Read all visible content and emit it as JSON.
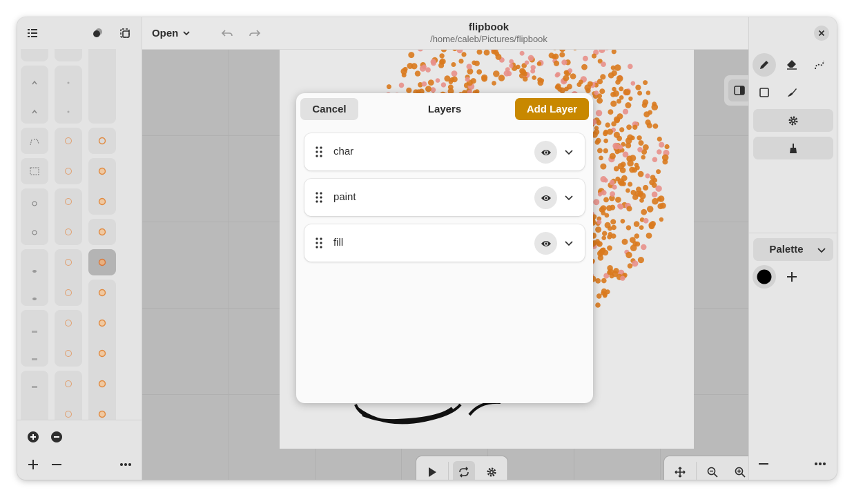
{
  "header": {
    "title": "flipbook",
    "subtitle": "/home/caleb/Pictures/flipbook",
    "open_label": "Open"
  },
  "dialog": {
    "title": "Layers",
    "cancel_label": "Cancel",
    "add_label": "Add Layer",
    "layers": [
      {
        "name": "char"
      },
      {
        "name": "paint"
      },
      {
        "name": "fill"
      }
    ]
  },
  "palette": {
    "label": "Palette",
    "colors": [
      "#000000"
    ]
  },
  "colors": {
    "accent": "#c88800",
    "dots": "#d97a1e",
    "dots_light": "#e8908a"
  },
  "icons": {
    "sidebar": [
      "list-icon",
      "onion-skin-icon",
      "selection-icon",
      "add-circle-icon",
      "remove-circle-icon",
      "plus-icon",
      "minus-icon",
      "more-icon"
    ],
    "topbar": [
      "undo-icon",
      "redo-icon",
      "menu-icon",
      "close-icon"
    ],
    "tools": [
      "pencil-icon",
      "eraser-icon",
      "dotted-line-icon",
      "rectangle-icon",
      "brush-icon",
      "settings-icon",
      "broom-icon"
    ],
    "playback": [
      "play-icon",
      "loop-icon",
      "settings-icon"
    ],
    "view": [
      "move-icon",
      "zoom-out-icon",
      "zoom-in-icon"
    ]
  }
}
